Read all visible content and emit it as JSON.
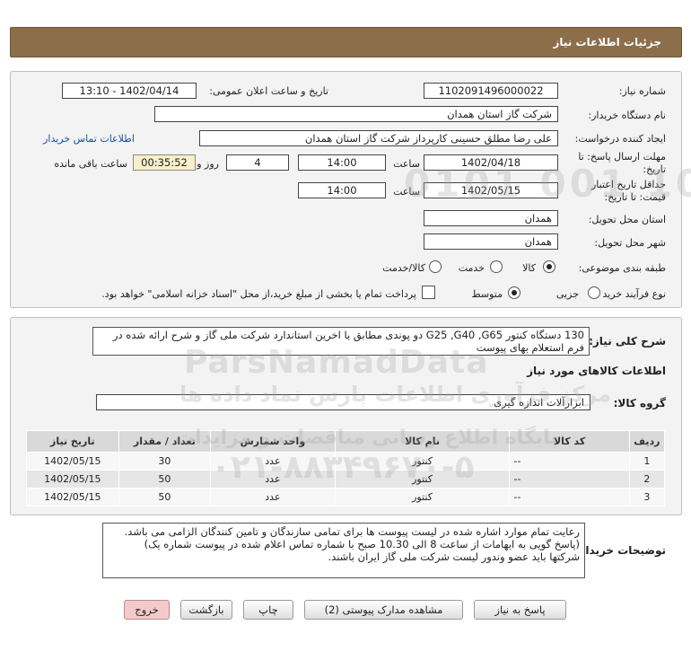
{
  "header": {
    "title": "جزئیات اطلاعات نیاز"
  },
  "info": {
    "need_number_label": "شماره نیاز:",
    "need_number": "1102091496000022",
    "announce_label": "تاریخ و ساعت اعلان عمومی:",
    "announce_value": "1402/04/14 - 13:10",
    "buyer_org_label": "نام دستگاه خریدار:",
    "buyer_org": "شرکت گاز استان همدان",
    "creator_label": "ایجاد کننده درخواست:",
    "creator": "علی رضا مطلق حسینی کارپرداز شرکت گاز استان همدان",
    "contact_link": "اطلاعات تماس خریدار",
    "deadline_label_1": "مهلت ارسال پاسخ: تا",
    "deadline_label_2": "تاریخ:",
    "deadline_date": "1402/04/18",
    "time_label": "ساعت",
    "deadline_time": "14:00",
    "days_value": "4",
    "days_label": "روز و",
    "remaining_time": "00:35:52",
    "remaining_label": "ساعت باقی مانده",
    "validity_label_1": "حداقل تاریخ اعتبار",
    "validity_label_2": "قیمت: تا تاریخ:",
    "validity_date": "1402/05/15",
    "validity_time_label": "ساعت",
    "validity_time": "14:00",
    "province_label": "استان محل تحویل:",
    "province": "همدان",
    "city_label": "شهر محل تحویل:",
    "city": "همدان",
    "category_label": "طبقه بندی موضوعی:",
    "category_options": [
      "کالا",
      "خدمت",
      "کالا/خدمت"
    ],
    "process_label": "نوع فرآیند خرید :",
    "process_options": [
      "جزیی",
      "متوسط"
    ],
    "payment_note": "پرداخت تمام یا بخشی از مبلغ خرید،از محل \"اسناد خزانه اسلامی\" خواهد بود."
  },
  "summary": {
    "label": "شرح کلی نیاز:",
    "text": "130 دستگاه کنتور G25 ,G40 ,G65 دو پوندی مطابق با اخرین استاندارد شرکت ملی گاز و شرح ارائه شده در فرم استعلام بهای پیوست"
  },
  "goods": {
    "section_title": "اطلاعات کالاهای مورد نیاز",
    "group_label": "گروه کالا:",
    "group_value": "ابزارآلات اندازه گیری",
    "columns": [
      "ردیف",
      "کد کالا",
      "نام کالا",
      "واحد شمارش",
      "تعداد / مقدار",
      "تاریخ نیاز"
    ],
    "rows": [
      [
        "1",
        "--",
        "کنتور",
        "عدد",
        "30",
        "1402/05/15"
      ],
      [
        "2",
        "--",
        "کنتور",
        "عدد",
        "50",
        "1402/05/15"
      ],
      [
        "3",
        "--",
        "کنتور",
        "عدد",
        "50",
        "1402/05/15"
      ]
    ]
  },
  "buyer_notes": {
    "label": "توضیحات خریدار:",
    "line1": "رعایت تمام موارد اشاره شده در لیست پیوست ها برای تمامی سازندگان و تامین کنندگان الزامی می باشد.(پاسخ گویی به ابهامات از ساعت 8 الی 10.30 صبح با شماره تماس اعلام شده در پیوست شماره یک)",
    "line2": "شرکتها باید عضو وندور لیست شرکت ملی گاز  ایران باشند."
  },
  "buttons": {
    "reply": "پاسخ به نیاز",
    "attachments": "مشاهده مدارک پیوستی (2)",
    "print": "چاپ",
    "back": "بازگشت",
    "exit": "خروج"
  },
  "watermark": {
    "brand": "ParsNamadData",
    "line_fa_1": "مرکز فرآوری اطلاعات پارس نماد داده ها",
    "line_fa_2": "پایگاه اطلاع رسانی مناقصات و مزایدات",
    "phone": "۰۲۱-۸۸۳۴۹۶۷۰-۵",
    "digits": "0101 001 10"
  },
  "colors": {
    "header_bg": "#8c6e4b",
    "link": "#1a4fa0",
    "exit_button": "#f4c9c9"
  }
}
